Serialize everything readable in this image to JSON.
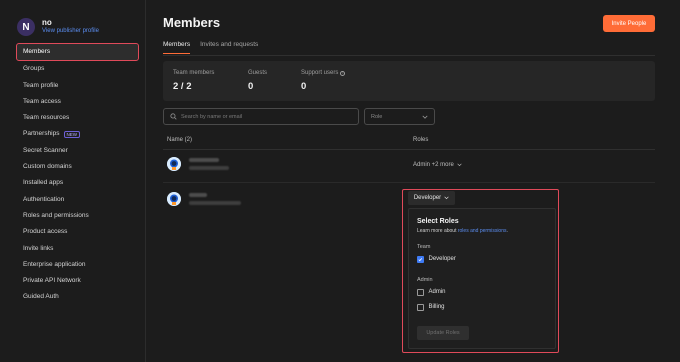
{
  "workspace": {
    "initial": "N",
    "name": "no",
    "link_text": "View publisher profile"
  },
  "sidebar": {
    "items": [
      {
        "label": "Members"
      },
      {
        "label": "Groups"
      },
      {
        "label": "Team profile"
      },
      {
        "label": "Team access"
      },
      {
        "label": "Team resources"
      },
      {
        "label": "Partnerships",
        "badge": "NEW"
      },
      {
        "label": "Secret Scanner"
      },
      {
        "label": "Custom domains"
      },
      {
        "label": "Installed apps"
      },
      {
        "label": "Authentication"
      },
      {
        "label": "Roles and permissions"
      },
      {
        "label": "Product access"
      },
      {
        "label": "Invite links"
      },
      {
        "label": "Enterprise application"
      },
      {
        "label": "Private API Network"
      },
      {
        "label": "Guided Auth"
      }
    ]
  },
  "header": {
    "title": "Members",
    "invite_button": "Invite People"
  },
  "tabs": [
    {
      "label": "Members"
    },
    {
      "label": "Invites and requests"
    }
  ],
  "stats": {
    "team_members": {
      "label": "Team members",
      "value": "2 / 2"
    },
    "guests": {
      "label": "Guests",
      "value": "0"
    },
    "support_users": {
      "label": "Support users",
      "value": "0"
    }
  },
  "filters": {
    "search_placeholder": "Search by name or email",
    "role_placeholder": "Role"
  },
  "table": {
    "name_header": "Name (2)",
    "roles_header": "Roles",
    "rows": [
      {
        "roles": "Admin +2 more"
      },
      {
        "roles": "Developer"
      }
    ]
  },
  "role_popover": {
    "title": "Select Roles",
    "subtitle_prefix": "Learn more about ",
    "subtitle_link": "roles and permissions",
    "subtitle_suffix": ".",
    "team_label": "Team",
    "developer_label": "Developer",
    "admin_label": "Admin",
    "admin_option": "Admin",
    "billing_option": "Billing",
    "update_button": "Update Roles"
  },
  "colors": {
    "accent": "#ff6c37",
    "link": "#5b8def",
    "highlight": "#e04a5a",
    "checkbox": "#3e7bf6"
  }
}
